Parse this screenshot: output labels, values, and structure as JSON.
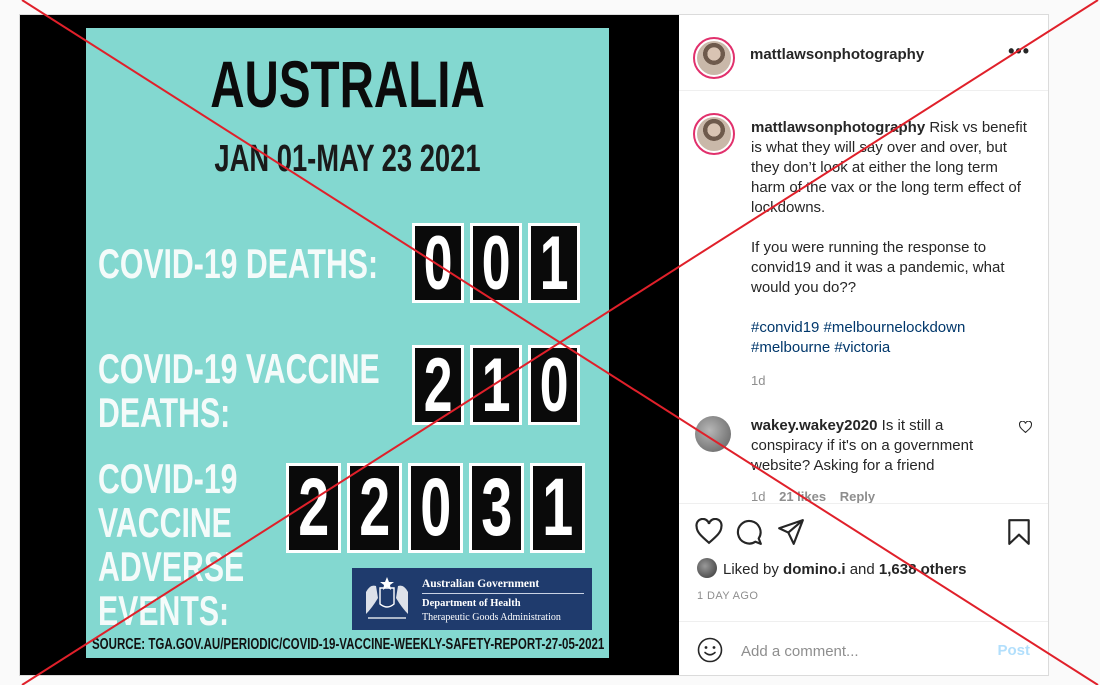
{
  "poster": {
    "title": "AUSTRALIA",
    "date_range": "JAN 01-MAY 23 2021",
    "rows": [
      {
        "label_lines": [
          "COVID-19 DEATHS:"
        ],
        "digits": [
          "0",
          "0",
          "1"
        ]
      },
      {
        "label_lines": [
          "COVID-19 VACCINE",
          "DEATHS:"
        ],
        "digits": [
          "2",
          "1",
          "0"
        ]
      },
      {
        "label_lines": [
          "COVID-19",
          "VACCINE",
          "ADVERSE",
          "EVENTS:"
        ],
        "digits": [
          "2",
          "2",
          "0",
          "3",
          "1"
        ]
      }
    ],
    "gov_badge": {
      "title": "Australian Government",
      "department": "Department of Health",
      "agency": "Therapeutic Goods Administration"
    },
    "source": "SOURCE: TGA.GOV.AU/PERIODIC/COVID-19-VACCINE-WEEKLY-SAFETY-REPORT-27-05-2021"
  },
  "header": {
    "username": "mattlawsonphotography",
    "more_label": "•••"
  },
  "caption": {
    "username": "mattlawsonphotography",
    "text_p1": "Risk vs benefit is what they will say over and over, but they don’t look at either the long term harm of the vax or the long term effect of lockdowns.",
    "text_p2": "If you were running the response to convid19 and it was a pandemic, what would you do??",
    "hashtags": "#convid19 #melbournelockdown #melbourne #victoria",
    "time": "1d"
  },
  "reply": {
    "username": "wakey.wakey2020",
    "text": "Is it still a conspiracy if it's on a government website? Asking for a friend",
    "time": "1d",
    "likes": "21 likes",
    "reply_label": "Reply"
  },
  "engagement": {
    "liked_by_prefix": "Liked by",
    "liked_by_user": "domino.i",
    "and": "and",
    "others": "1,638 others",
    "post_date": "1 DAY AGO"
  },
  "comment_box": {
    "placeholder": "Add a comment...",
    "post_label": "Post"
  },
  "colors": {
    "poster_bg": "#83d8d0",
    "hashtag": "#00376b",
    "cross": "#e0202a",
    "post_button_disabled": "#b2dffc"
  }
}
